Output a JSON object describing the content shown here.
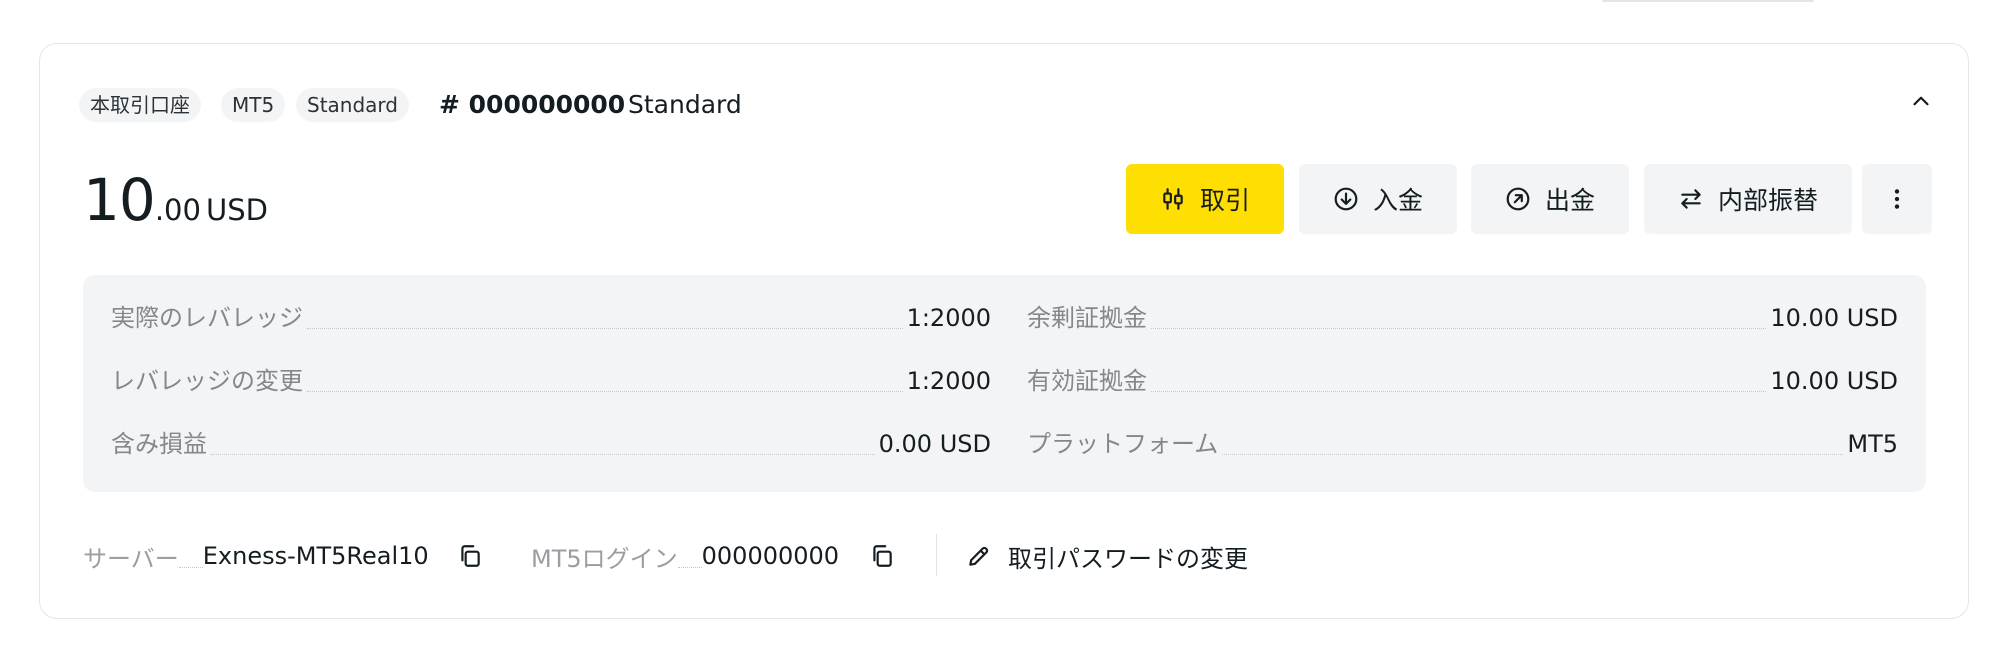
{
  "header": {
    "tags": [
      "本取引口座",
      "MT5",
      "Standard"
    ],
    "account_number": "# 000000000",
    "account_name": "Standard",
    "collapse_icon": "chevron-up-icon"
  },
  "balance": {
    "integer": "10",
    "decimal": ".00",
    "currency": "USD"
  },
  "actions": {
    "trade_label": "取引",
    "deposit_label": "入金",
    "withdraw_label": "出金",
    "transfer_label": "内部振替",
    "more_icon": "more-vertical-icon",
    "accent_color": "#ffde02"
  },
  "stats": {
    "left": [
      {
        "label": "実際のレバレッジ",
        "value": "1:2000"
      },
      {
        "label": "レバレッジの変更",
        "value": "1:2000"
      },
      {
        "label": "含み損益",
        "value": "0.00 USD"
      }
    ],
    "right": [
      {
        "label": "余剰証拠金",
        "value": "10.00 USD"
      },
      {
        "label": "有効証拠金",
        "value": "10.00 USD"
      },
      {
        "label": "プラットフォーム",
        "value": "MT5"
      }
    ]
  },
  "footer": {
    "server_label": "サーバー",
    "server_value": "Exness-MT5Real10",
    "login_label": "MT5ログイン",
    "login_value": "000000000",
    "change_password_label": "取引パスワードの変更"
  }
}
